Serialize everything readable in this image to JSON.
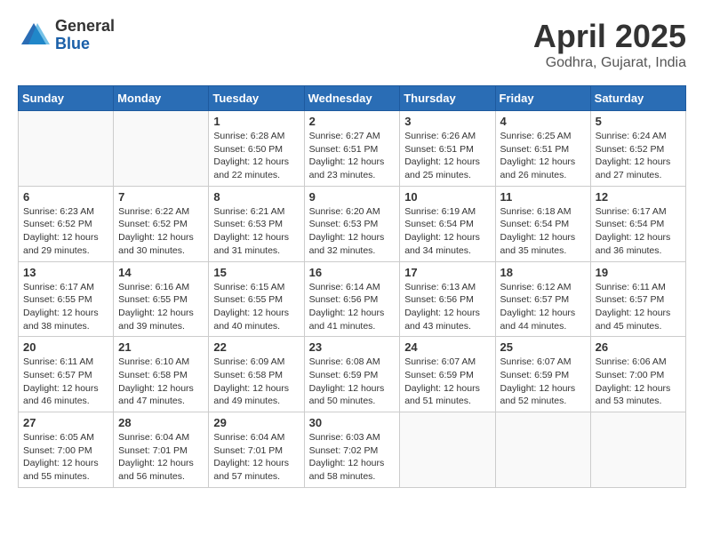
{
  "logo": {
    "general": "General",
    "blue": "Blue"
  },
  "header": {
    "title": "April 2025",
    "location": "Godhra, Gujarat, India"
  },
  "weekdays": [
    "Sunday",
    "Monday",
    "Tuesday",
    "Wednesday",
    "Thursday",
    "Friday",
    "Saturday"
  ],
  "weeks": [
    [
      {
        "day": "",
        "info": ""
      },
      {
        "day": "",
        "info": ""
      },
      {
        "day": "1",
        "info": "Sunrise: 6:28 AM\nSunset: 6:50 PM\nDaylight: 12 hours\nand 22 minutes."
      },
      {
        "day": "2",
        "info": "Sunrise: 6:27 AM\nSunset: 6:51 PM\nDaylight: 12 hours\nand 23 minutes."
      },
      {
        "day": "3",
        "info": "Sunrise: 6:26 AM\nSunset: 6:51 PM\nDaylight: 12 hours\nand 25 minutes."
      },
      {
        "day": "4",
        "info": "Sunrise: 6:25 AM\nSunset: 6:51 PM\nDaylight: 12 hours\nand 26 minutes."
      },
      {
        "day": "5",
        "info": "Sunrise: 6:24 AM\nSunset: 6:52 PM\nDaylight: 12 hours\nand 27 minutes."
      }
    ],
    [
      {
        "day": "6",
        "info": "Sunrise: 6:23 AM\nSunset: 6:52 PM\nDaylight: 12 hours\nand 29 minutes."
      },
      {
        "day": "7",
        "info": "Sunrise: 6:22 AM\nSunset: 6:52 PM\nDaylight: 12 hours\nand 30 minutes."
      },
      {
        "day": "8",
        "info": "Sunrise: 6:21 AM\nSunset: 6:53 PM\nDaylight: 12 hours\nand 31 minutes."
      },
      {
        "day": "9",
        "info": "Sunrise: 6:20 AM\nSunset: 6:53 PM\nDaylight: 12 hours\nand 32 minutes."
      },
      {
        "day": "10",
        "info": "Sunrise: 6:19 AM\nSunset: 6:54 PM\nDaylight: 12 hours\nand 34 minutes."
      },
      {
        "day": "11",
        "info": "Sunrise: 6:18 AM\nSunset: 6:54 PM\nDaylight: 12 hours\nand 35 minutes."
      },
      {
        "day": "12",
        "info": "Sunrise: 6:17 AM\nSunset: 6:54 PM\nDaylight: 12 hours\nand 36 minutes."
      }
    ],
    [
      {
        "day": "13",
        "info": "Sunrise: 6:17 AM\nSunset: 6:55 PM\nDaylight: 12 hours\nand 38 minutes."
      },
      {
        "day": "14",
        "info": "Sunrise: 6:16 AM\nSunset: 6:55 PM\nDaylight: 12 hours\nand 39 minutes."
      },
      {
        "day": "15",
        "info": "Sunrise: 6:15 AM\nSunset: 6:55 PM\nDaylight: 12 hours\nand 40 minutes."
      },
      {
        "day": "16",
        "info": "Sunrise: 6:14 AM\nSunset: 6:56 PM\nDaylight: 12 hours\nand 41 minutes."
      },
      {
        "day": "17",
        "info": "Sunrise: 6:13 AM\nSunset: 6:56 PM\nDaylight: 12 hours\nand 43 minutes."
      },
      {
        "day": "18",
        "info": "Sunrise: 6:12 AM\nSunset: 6:57 PM\nDaylight: 12 hours\nand 44 minutes."
      },
      {
        "day": "19",
        "info": "Sunrise: 6:11 AM\nSunset: 6:57 PM\nDaylight: 12 hours\nand 45 minutes."
      }
    ],
    [
      {
        "day": "20",
        "info": "Sunrise: 6:11 AM\nSunset: 6:57 PM\nDaylight: 12 hours\nand 46 minutes."
      },
      {
        "day": "21",
        "info": "Sunrise: 6:10 AM\nSunset: 6:58 PM\nDaylight: 12 hours\nand 47 minutes."
      },
      {
        "day": "22",
        "info": "Sunrise: 6:09 AM\nSunset: 6:58 PM\nDaylight: 12 hours\nand 49 minutes."
      },
      {
        "day": "23",
        "info": "Sunrise: 6:08 AM\nSunset: 6:59 PM\nDaylight: 12 hours\nand 50 minutes."
      },
      {
        "day": "24",
        "info": "Sunrise: 6:07 AM\nSunset: 6:59 PM\nDaylight: 12 hours\nand 51 minutes."
      },
      {
        "day": "25",
        "info": "Sunrise: 6:07 AM\nSunset: 6:59 PM\nDaylight: 12 hours\nand 52 minutes."
      },
      {
        "day": "26",
        "info": "Sunrise: 6:06 AM\nSunset: 7:00 PM\nDaylight: 12 hours\nand 53 minutes."
      }
    ],
    [
      {
        "day": "27",
        "info": "Sunrise: 6:05 AM\nSunset: 7:00 PM\nDaylight: 12 hours\nand 55 minutes."
      },
      {
        "day": "28",
        "info": "Sunrise: 6:04 AM\nSunset: 7:01 PM\nDaylight: 12 hours\nand 56 minutes."
      },
      {
        "day": "29",
        "info": "Sunrise: 6:04 AM\nSunset: 7:01 PM\nDaylight: 12 hours\nand 57 minutes."
      },
      {
        "day": "30",
        "info": "Sunrise: 6:03 AM\nSunset: 7:02 PM\nDaylight: 12 hours\nand 58 minutes."
      },
      {
        "day": "",
        "info": ""
      },
      {
        "day": "",
        "info": ""
      },
      {
        "day": "",
        "info": ""
      }
    ]
  ]
}
